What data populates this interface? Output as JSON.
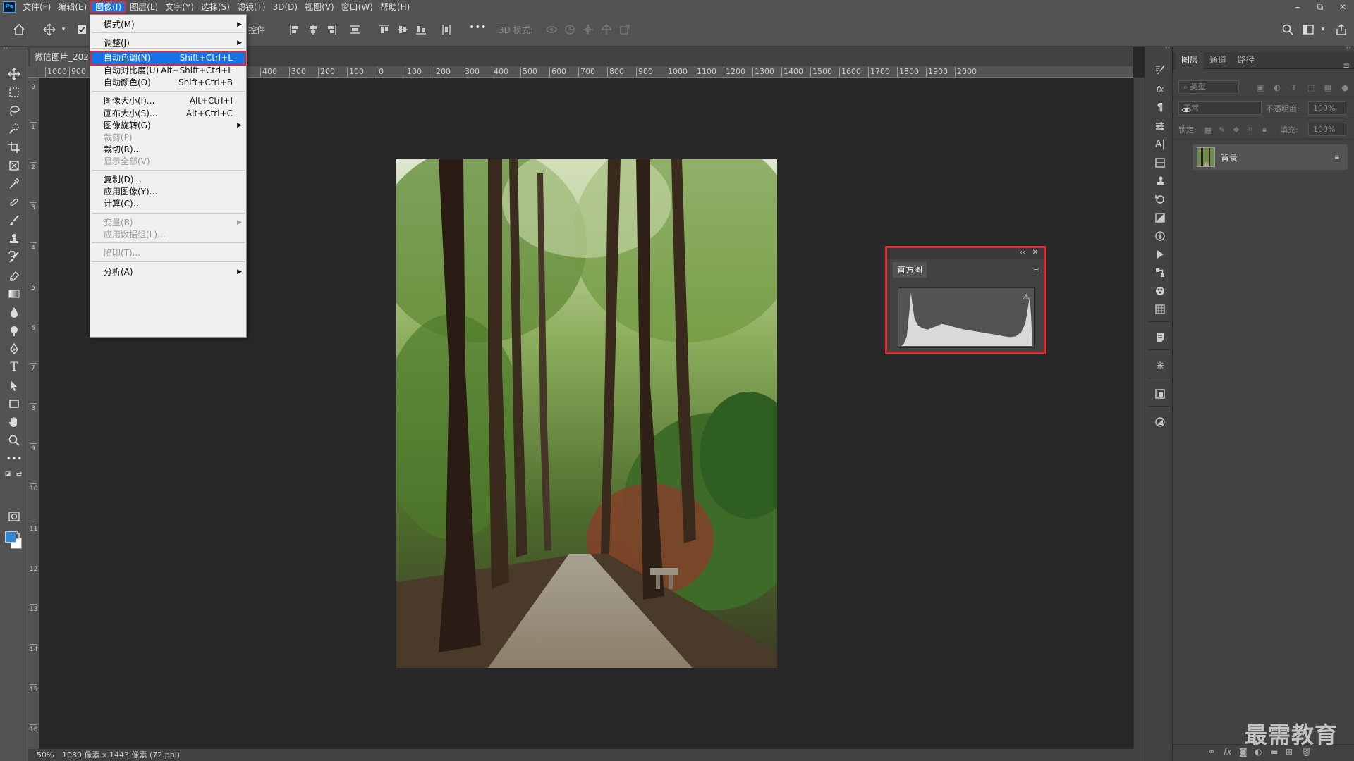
{
  "menubar": {
    "items": [
      "文件(F)",
      "编辑(E)",
      "图像(I)",
      "图层(L)",
      "文字(Y)",
      "选择(S)",
      "滤镜(T)",
      "3D(D)",
      "视图(V)",
      "窗口(W)",
      "帮助(H)"
    ],
    "active_index": 2,
    "window_controls": [
      "–",
      "⧉",
      "✕"
    ]
  },
  "options_bar": {
    "controls_label": "控件",
    "more": "•••",
    "mode_3d_label": "3D 模式:"
  },
  "document": {
    "tab_title": "微信图片_202",
    "zoom": "50%",
    "info": "1080 像素 x 1443 像素 (72 ppi)",
    "ruler_top": [
      "1000",
      "900",
      "400",
      "300",
      "200",
      "100",
      "0",
      "100",
      "200",
      "300",
      "400",
      "500",
      "600",
      "700",
      "800",
      "900",
      "1000",
      "1100",
      "1200",
      "1300",
      "1400",
      "1500",
      "1600",
      "1700",
      "1800",
      "1900",
      "2000"
    ],
    "ruler_left": [
      "0",
      "1",
      "2",
      "3",
      "4",
      "5",
      "6",
      "7",
      "8",
      "9",
      "10",
      "11",
      "12",
      "13",
      "14",
      "15",
      "16"
    ]
  },
  "image_menu": {
    "items": [
      {
        "label": "模式(M)",
        "shortcut": "",
        "submenu": true,
        "disabled": false
      },
      {
        "label": "调整(J)",
        "shortcut": "",
        "submenu": true,
        "disabled": false
      },
      {
        "label": "自动色调(N)",
        "shortcut": "Shift+Ctrl+L",
        "submenu": false,
        "disabled": false,
        "highlighted": true
      },
      {
        "label": "自动对比度(U)",
        "shortcut": "Alt+Shift+Ctrl+L",
        "submenu": false,
        "disabled": false
      },
      {
        "label": "自动颜色(O)",
        "shortcut": "Shift+Ctrl+B",
        "submenu": false,
        "disabled": false
      },
      {
        "label": "图像大小(I)...",
        "shortcut": "Alt+Ctrl+I",
        "submenu": false,
        "disabled": false
      },
      {
        "label": "画布大小(S)...",
        "shortcut": "Alt+Ctrl+C",
        "submenu": false,
        "disabled": false
      },
      {
        "label": "图像旋转(G)",
        "shortcut": "",
        "submenu": true,
        "disabled": false
      },
      {
        "label": "裁剪(P)",
        "shortcut": "",
        "submenu": false,
        "disabled": true
      },
      {
        "label": "裁切(R)...",
        "shortcut": "",
        "submenu": false,
        "disabled": false
      },
      {
        "label": "显示全部(V)",
        "shortcut": "",
        "submenu": false,
        "disabled": true
      },
      {
        "label": "复制(D)...",
        "shortcut": "",
        "submenu": false,
        "disabled": false
      },
      {
        "label": "应用图像(Y)...",
        "shortcut": "",
        "submenu": false,
        "disabled": false
      },
      {
        "label": "计算(C)...",
        "shortcut": "",
        "submenu": false,
        "disabled": false
      },
      {
        "label": "变量(B)",
        "shortcut": "",
        "submenu": true,
        "disabled": true
      },
      {
        "label": "应用数据组(L)...",
        "shortcut": "",
        "submenu": false,
        "disabled": true
      },
      {
        "label": "陷印(T)...",
        "shortcut": "",
        "submenu": false,
        "disabled": true
      },
      {
        "label": "分析(A)",
        "shortcut": "",
        "submenu": true,
        "disabled": false
      }
    ]
  },
  "histogram_panel": {
    "collapse": "‹‹",
    "close": "✕",
    "tab": "直方图",
    "menu": "≡",
    "warning": "⚠"
  },
  "layers_panel": {
    "tabs": [
      "图层",
      "通道",
      "路径"
    ],
    "active_tab": 0,
    "filter_placeholder": "类型",
    "blend_mode": "正常",
    "opacity_label": "不透明度:",
    "opacity_value": "100%",
    "lock_label": "锁定:",
    "fill_label": "填充:",
    "fill_value": "100%",
    "layers": [
      {
        "name": "背景",
        "visible": true,
        "locked": true
      }
    ]
  },
  "watermark": "最需教育",
  "colors": {
    "foreground": "#2e8ad8",
    "background": "#ffffff",
    "highlight": "#1473e6",
    "annotation_red": "#e0292e"
  }
}
